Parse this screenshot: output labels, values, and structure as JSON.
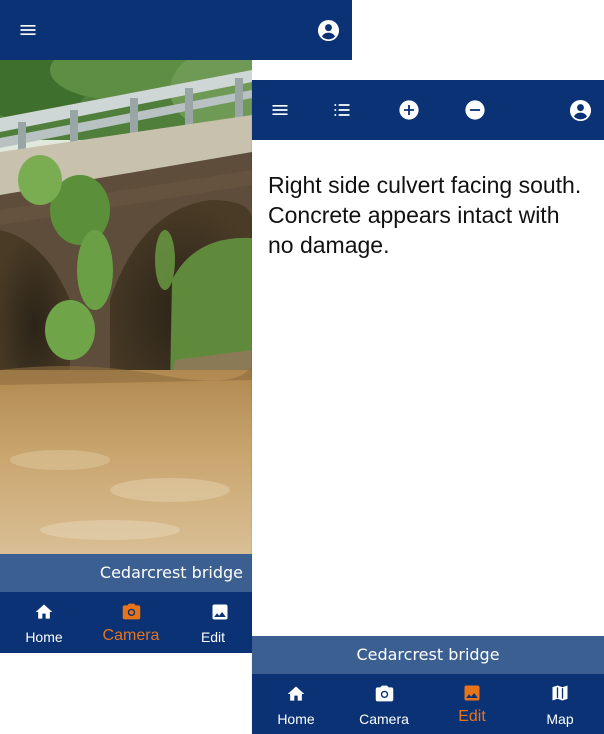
{
  "colors": {
    "primary": "#0a3275",
    "caption_bar": "#3a5f90",
    "active": "#e8741a",
    "icon": "#ffffff"
  },
  "camera_screen": {
    "caption": "Cedarcrest bridge",
    "nav": [
      {
        "label": "Home",
        "icon": "home-icon",
        "active": false
      },
      {
        "label": "Camera",
        "icon": "camera-icon",
        "active": true
      },
      {
        "label": "Edit",
        "icon": "image-icon",
        "active": false
      }
    ]
  },
  "edit_screen": {
    "note_text": "Right side culvert facing south. Concrete appears intact with no damage.",
    "caption": "Cedarcrest bridge",
    "nav": [
      {
        "label": "Home",
        "icon": "home-icon",
        "active": false
      },
      {
        "label": "Camera",
        "icon": "camera-icon",
        "active": false
      },
      {
        "label": "Edit",
        "icon": "image-icon",
        "active": true
      },
      {
        "label": "Map",
        "icon": "map-icon",
        "active": false
      }
    ]
  }
}
